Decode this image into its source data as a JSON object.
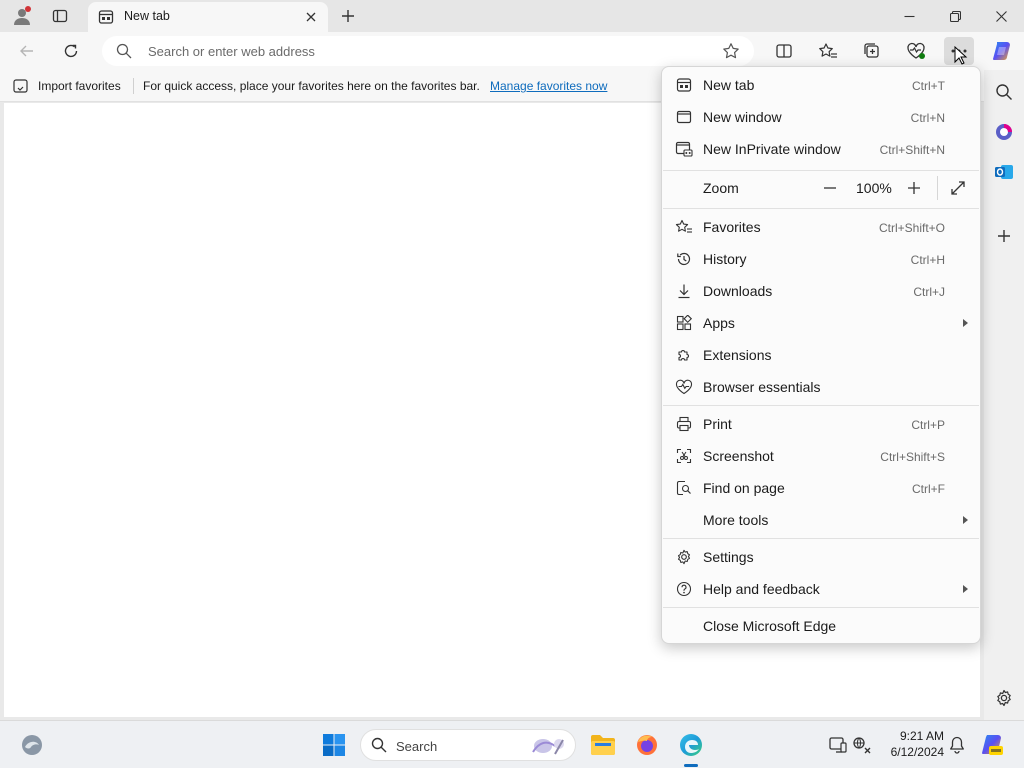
{
  "window": {
    "tab_title": "New tab",
    "minimize_label": "",
    "new_tab_button": "+"
  },
  "toolbar": {
    "address_placeholder": "Search or enter web address"
  },
  "favorites_bar": {
    "import_label": "Import favorites",
    "message": "For quick access, place your favorites here on the favorites bar.",
    "manage_link": "Manage favorites now"
  },
  "menu": {
    "items": [
      {
        "label": "New tab",
        "shortcut": "Ctrl+T",
        "icon": "new-tab-icon"
      },
      {
        "label": "New window",
        "shortcut": "Ctrl+N",
        "icon": "new-window-icon"
      },
      {
        "label": "New InPrivate window",
        "shortcut": "Ctrl+Shift+N",
        "icon": "inprivate-icon"
      },
      {
        "label": "Zoom",
        "shortcut": "",
        "icon": ""
      },
      {
        "label": "Favorites",
        "shortcut": "Ctrl+Shift+O",
        "icon": "favorites-icon"
      },
      {
        "label": "History",
        "shortcut": "Ctrl+H",
        "icon": "history-icon"
      },
      {
        "label": "Downloads",
        "shortcut": "Ctrl+J",
        "icon": "downloads-icon"
      },
      {
        "label": "Apps",
        "shortcut": "",
        "icon": "apps-icon",
        "submenu": true
      },
      {
        "label": "Extensions",
        "shortcut": "",
        "icon": "extensions-icon"
      },
      {
        "label": "Browser essentials",
        "shortcut": "",
        "icon": "browser-essentials-icon"
      },
      {
        "label": "Print",
        "shortcut": "Ctrl+P",
        "icon": "print-icon"
      },
      {
        "label": "Screenshot",
        "shortcut": "Ctrl+Shift+S",
        "icon": "screenshot-icon"
      },
      {
        "label": "Find on page",
        "shortcut": "Ctrl+F",
        "icon": "find-icon"
      },
      {
        "label": "More tools",
        "shortcut": "",
        "icon": "",
        "submenu": true
      },
      {
        "label": "Settings",
        "shortcut": "",
        "icon": "settings-icon"
      },
      {
        "label": "Help and feedback",
        "shortcut": "",
        "icon": "help-icon",
        "submenu": true
      },
      {
        "label": "Close Microsoft Edge",
        "shortcut": "",
        "icon": ""
      }
    ],
    "zoom": {
      "value": "100%",
      "minus": "—",
      "plus": "+"
    }
  },
  "taskbar": {
    "search_label": "Search",
    "time": "9:21 AM",
    "date": "6/12/2024"
  },
  "colors": {
    "accent": "#0f6cbd",
    "link": "#0f6cbd"
  }
}
